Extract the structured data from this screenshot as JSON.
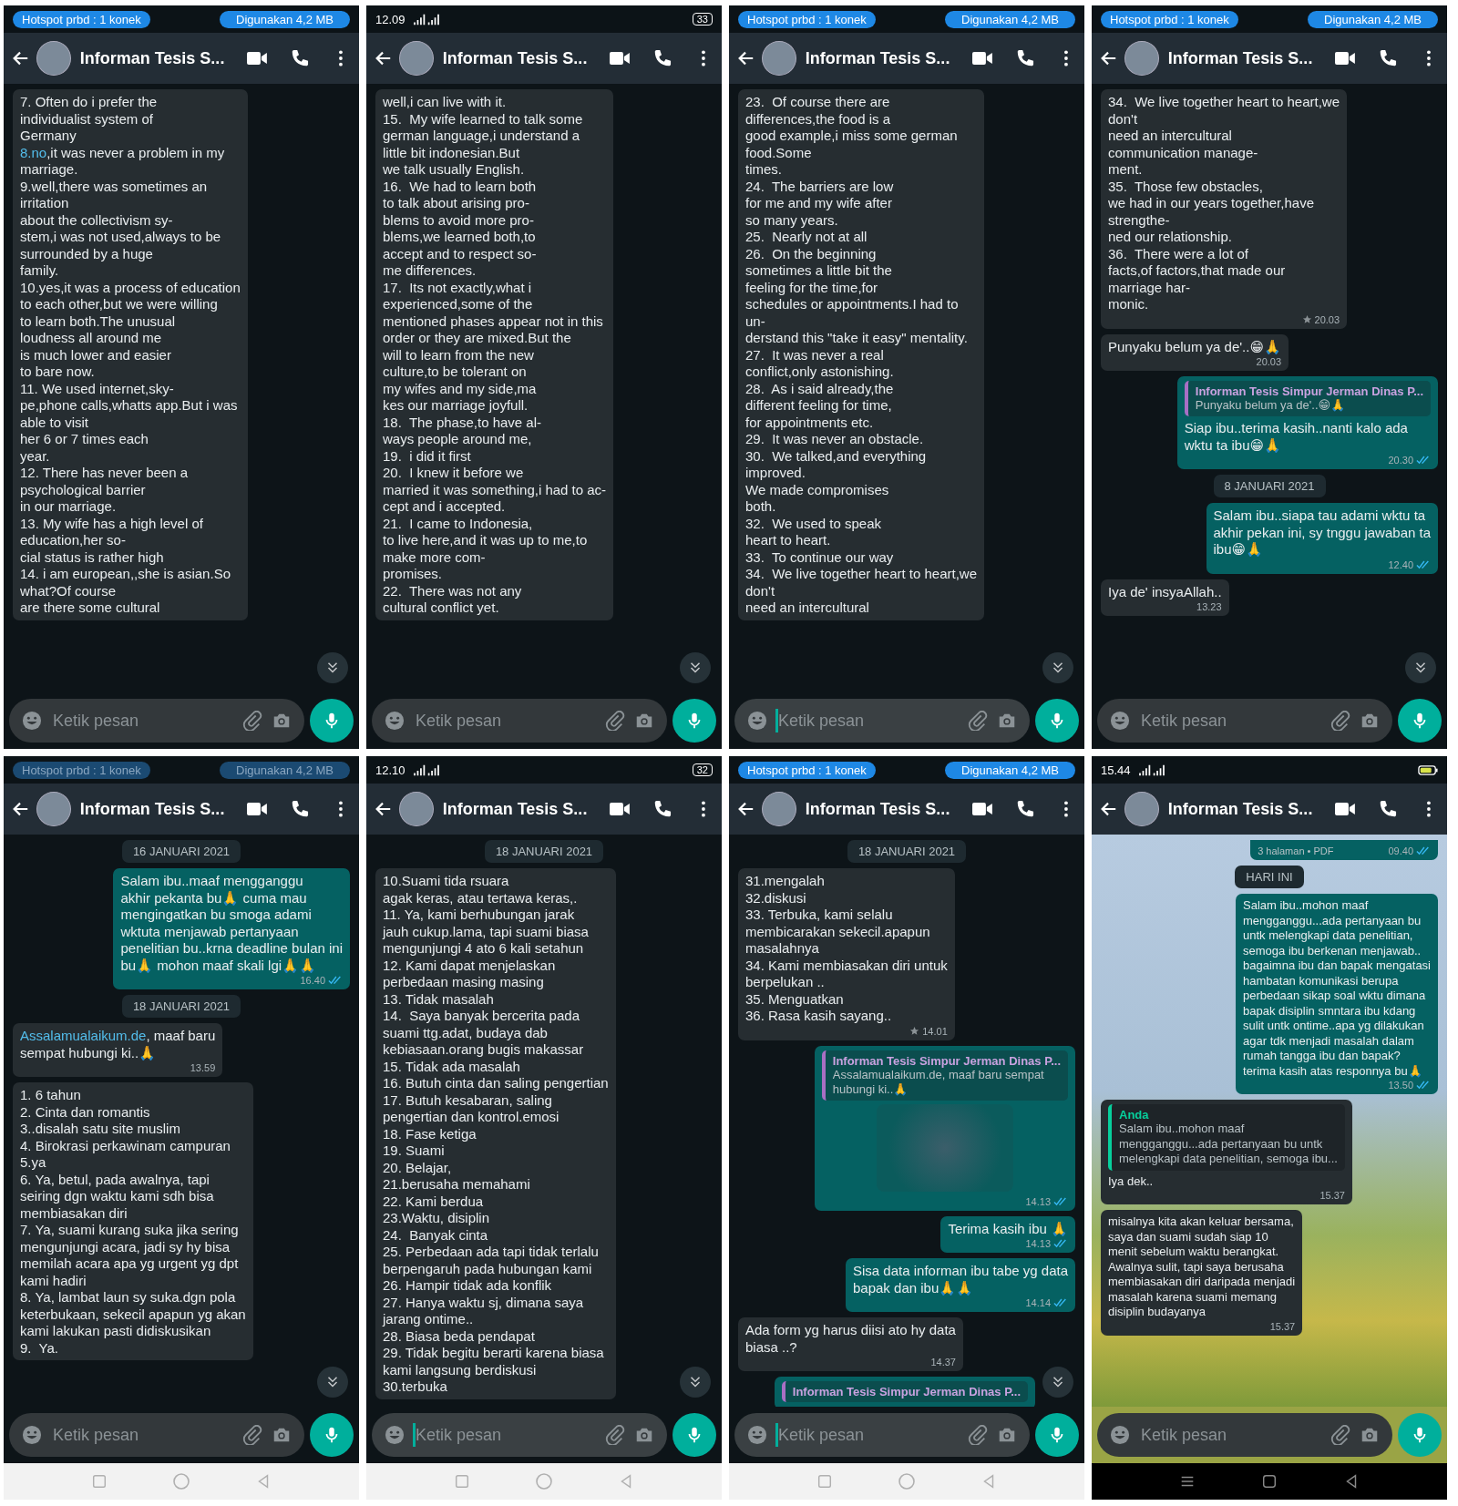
{
  "panels": [
    {
      "status_bar": {
        "kind": "hotspot",
        "hotspot": "Hotspot prbd : 1 konek",
        "usage": "Digunakan 4,2 MB",
        "faded": false
      },
      "header": {
        "title": "Informan Tesis S..."
      },
      "wallpaper": false,
      "scroll_button": true,
      "composer": {
        "placeholder": "Ketik pesan",
        "focused": false
      },
      "messages": [
        {
          "kind": "in",
          "parts": [
            {
              "text": "7. Often do i prefer the\nindividualist system of\nGermany\n",
              "link": false
            },
            {
              "text": "8.no",
              "link": true
            },
            {
              "text": ",it was never a problem in my\nmarriage.\n9.well,there was sometimes an\nirritation\nabout the collectivism sy-\nstem,i was not used,always to be\nsurrounded by a huge\nfamily.\n10.yes,it was a process of education\nto each other,but we were willing\nto learn both.The unusual\nloudness all around me\nis much lower and easier\nto bare now.\n11. We used internet,sky-\npe,phone calls,whatts app.But i was\nable to visit\nher 6 or 7 times each\nyear.\n12. There has never been a\npsychological barrier\nin our marriage.\n13. My wife has a high level of\neducation,her so-\ncial status is rather high\n14. i am european,,she is asian.So\nwhat?Of course\nare there some cultural",
              "link": false
            }
          ]
        }
      ]
    },
    {
      "status_bar": {
        "kind": "phone",
        "time": "12.09",
        "battery": "33"
      },
      "header": {
        "title": "Informan Tesis S..."
      },
      "wallpaper": false,
      "scroll_button": true,
      "composer": {
        "placeholder": "Ketik pesan",
        "focused": false
      },
      "messages": [
        {
          "kind": "in",
          "text": "well,i can live with it.\n15.  My wife learned to talk some\ngerman language,i understand a\nlittle bit indonesian.But\nwe talk usually English.\n16.  We had to learn both\nto talk about arising pro-\nblems to avoid more pro-\nblems,we learned both,to\naccept and to respect so-\nme differences.\n17.  Its not exactly,what i\nexperienced,some of the\nmentioned phases appear not in this\norder or they are mixed.But the\nwill to learn from the new\nculture,to be tolerant on\nmy wifes and my side,ma\nkes our marriage joyfull.\n18.  The phase,to have al-\nways people around me,\n19.  i did it first\n20.  I knew it before we\nmarried it was something,i had to ac-\ncept and i accepted.\n21.  I came to Indonesia,\nto live here,and it was up to me,to\nmake more com-\npromises.\n22.  There was not any\ncultural conflict yet."
        }
      ]
    },
    {
      "status_bar": {
        "kind": "hotspot",
        "hotspot": "Hotspot prbd : 1 konek",
        "usage": "Digunakan 4,2 MB",
        "faded": false
      },
      "header": {
        "title": "Informan Tesis S..."
      },
      "wallpaper": false,
      "scroll_button": true,
      "composer": {
        "placeholder": "Ketik pesan",
        "focused": true
      },
      "messages": [
        {
          "kind": "in",
          "text": "23.  Of course there are\ndifferences,the food is a\ngood example,i miss some german\nfood.Some\ntimes.\n24.  The barriers are low\nfor me and my wife after\nso many years.\n25.  Nearly not at all\n26.  On the beginning\nsometimes a little bit the\nfeeling for the time,for\nschedules or appointments.I had to\nun-\nderstand this \"take it easy\" mentality.\n27.  It was never a real\nconflict,only astonishing.\n28.  As i said already,the\ndifferent feeling for time,\nfor appointments etc.\n29.  It was never an obstacle.\n30.  We talked,and everything\nimproved.\nWe made compromises\nboth.\n32.  We used to speak\nheart to heart.\n33.  To continue our way\n34.  We live together heart to heart,we\ndon't\nneed an intercultural"
        }
      ]
    },
    {
      "status_bar": {
        "kind": "hotspot",
        "hotspot": "Hotspot prbd : 1 konek",
        "usage": "Digunakan 4,2 MB",
        "faded": false
      },
      "header": {
        "title": "Informan Tesis S..."
      },
      "wallpaper": false,
      "scroll_button": true,
      "composer": {
        "placeholder": "Ketik pesan",
        "focused": false
      },
      "messages": [
        {
          "kind": "in",
          "text": "34.  We live together heart to heart,we\ndon't\nneed an intercultural\ncommunication manage-\nment.\n35.  Those few obstacles,\nwe had in our years together,have\nstrengthe-\nned our relationship.\n36.  There were a lot of\nfacts,of factors,that made our\nmarriage har-\nmonic.",
          "time": "20.03",
          "starred": true
        },
        {
          "kind": "in",
          "text": "Punyaku belum ya de'..😁🙏",
          "time": "20.03",
          "starred": false
        },
        {
          "kind": "out",
          "quote": {
            "author": "Informan Tesis Simpur Jerman Dinas P...",
            "text": "Punyaku belum ya de'..😁🙏"
          },
          "text": "Siap ibu..terima kasih..nanti kalo ada\nwktu ta ibu😁🙏",
          "time": "20.30",
          "read": true
        },
        {
          "kind": "date",
          "text": "8 JANUARI 2021"
        },
        {
          "kind": "out",
          "text": "Salam ibu..siapa tau adami wktu ta\nakhir pekan ini, sy tnggu jawaban ta\nibu😁🙏",
          "time": "12.40",
          "read": true
        },
        {
          "kind": "in",
          "text": "Iya de' insyaAllah..",
          "time": "13.23",
          "starred": false
        }
      ]
    },
    {
      "status_bar": {
        "kind": "hotspot",
        "hotspot": "Hotspot prbd : 1 konek",
        "usage": "Digunakan 4,2 MB",
        "faded": true
      },
      "header": {
        "title": "Informan Tesis S..."
      },
      "wallpaper": false,
      "scroll_button": true,
      "composer": {
        "placeholder": "Ketik pesan",
        "focused": false
      },
      "nav_bar": {
        "kind": "light"
      },
      "messages": [
        {
          "kind": "date",
          "text": "16 JANUARI 2021"
        },
        {
          "kind": "out",
          "text": "Salam ibu..maaf mengganggu\nakhir pekanta bu🙏 cuma mau\nmengingatkan bu smoga adami\nwktuta menjawab pertanyaan\npenelitian bu..krna deadline bulan ini\nbu🙏 mohon maaf skali lgi🙏🙏",
          "time": "16.40",
          "read": true
        },
        {
          "kind": "date",
          "text": "18 JANUARI 2021"
        },
        {
          "kind": "in",
          "parts": [
            {
              "text": "Assalamualaikum.de",
              "link": true
            },
            {
              "text": ", maaf baru\nsempat hubungi ki..🙏",
              "link": false
            }
          ],
          "time": "13.59",
          "starred": false
        },
        {
          "kind": "in",
          "text": "1. 6 tahun\n2. Cinta dan romantis\n3..disalah satu site muslim\n4. Birokrasi perkawinam campuran\n5.ya\n6. Ya, betul, pada awalnya, tapi\nseiring dgn waktu kami sdh bisa\nmembiasakan diri\n7. Ya, suami kurang suka jika sering\nmengunjungi acara, jadi sy hy bisa\nmemilah acara apa yg urgent yg dpt\nkami hadiri\n8. Ya, lambat laun sy suka.dgn pola\nketerbukaan, sekecil apapun yg akan\nkami lakukan pasti didiskusikan\n9.  Ya."
        }
      ]
    },
    {
      "status_bar": {
        "kind": "phone",
        "time": "12.10",
        "battery": "32"
      },
      "header": {
        "title": "Informan Tesis S..."
      },
      "wallpaper": false,
      "scroll_button": true,
      "composer": {
        "placeholder": "Ketik pesan",
        "focused": true
      },
      "nav_bar": {
        "kind": "light"
      },
      "messages": [
        {
          "kind": "date",
          "text": "18 JANUARI 2021"
        },
        {
          "kind": "in",
          "text": "10.Suami tida rsuara\nagak keras, atau tertawa keras,.\n11. Ya, kami berhubungan jarak\njauh cukup.lama, tapi suami biasa\nmengunjungi 4 ato 6 kali setahun\n12. Kami dapat menjelaskan\nperbedaan masing masing\n13. Tidak masalah\n14.  Saya banyak bercerita pada\nsuami ttg.adat, budaya dab\nkebiasaan.orang bugis makassar\n15. Tidak ada masalah\n16. Butuh cinta dan saling pengertian\n17. Butuh kesabaran, saling\npengertian dan kontrol.emosi\n18. Fase ketiga\n19. Suami\n20. Belajar,\n21.berusaha memahami\n22. Kami berdua\n23.Waktu, disiplin\n24.  Banyak cinta\n25. Perbedaan ada tapi tidak terlalu\nberpengaruh pada hubungan kami\n26. Hampir tidak ada konflik\n27. Hanya waktu sj, dimana saya\njarang ontime..\n28. Biasa beda pendapat\n29. Tidak begitu berarti karena biasa\nkami langsung berdiskusi\n30.terbuka"
        }
      ]
    },
    {
      "status_bar": {
        "kind": "hotspot",
        "hotspot": "Hotspot prbd : 1 konek",
        "usage": "Digunakan 4,2 MB",
        "faded": false
      },
      "header": {
        "title": "Informan Tesis S..."
      },
      "wallpaper": false,
      "scroll_button": true,
      "composer": {
        "placeholder": "Ketik pesan",
        "focused": true
      },
      "nav_bar": {
        "kind": "light"
      },
      "messages": [
        {
          "kind": "date",
          "text": "18 JANUARI 2021"
        },
        {
          "kind": "in",
          "text": "31.mengalah\n32.diskusi\n33. Terbuka, kami selalu\nmembicarakan sekecil.apapun\nmasalahnya\n34. Kami membiasakan diri untuk\nberpelukan ..\n35. Menguatkan\n36. Rasa kasih sayang..",
          "time": "14.01",
          "starred": true
        },
        {
          "kind": "out",
          "quote": {
            "author": "Informan Tesis Simpur Jerman Dinas P...",
            "text": "Assalamualaikum.de, maaf baru sempat\nhubungi ki..🙏"
          },
          "sticker": true,
          "time": "14.13",
          "read": true
        },
        {
          "kind": "out",
          "text": "Terima kasih ibu 🙏",
          "time": "14.13",
          "read": true
        },
        {
          "kind": "out",
          "text": "Sisa data informan ibu tabe yg data\nbapak dan ibu🙏🙏",
          "time": "14.14",
          "read": true
        },
        {
          "kind": "in",
          "text": "Ada form yg harus diisi ato hy data\nbiasa ..?",
          "time": "14.37",
          "starred": false
        },
        {
          "kind": "out",
          "quote": {
            "author": "Informan Tesis Simpur Jerman Dinas P..."
          }
        }
      ]
    },
    {
      "status_bar": {
        "kind": "phone",
        "time": "15.44"
      },
      "header": {
        "title": "Informan Tesis S..."
      },
      "wallpaper": true,
      "scroll_button": false,
      "composer": {
        "placeholder": "Ketik pesan",
        "focused": false
      },
      "nav_bar": {
        "kind": "dark"
      },
      "messages": [
        {
          "kind": "doc",
          "text": "3 halaman • PDF",
          "time": "09.40",
          "read": true
        },
        {
          "kind": "date",
          "text": "HARI INI"
        },
        {
          "kind": "out",
          "text": "Salam ibu..mohon maaf\nmengganggu...ada pertanyaan bu\nuntk melengkapi data penelitian,\nsemoga ibu berkenan menjawab..\nbagaimna ibu dan bapak mengatasi\nhambatan komunikasi berupa\nperbedaan sikap soal wktu dimana\nbapak disiplin smntara ibu kdang\nsulit untk ontime..apa yg dilakukan\nagar tdk menjadi masalah dalam\nrumah tangga ibu dan bapak?\nterima kasih atas responnya bu🙏",
          "time": "13.50",
          "read": true
        },
        {
          "kind": "in",
          "quote": {
            "author": "Anda",
            "text": "Salam ibu..mohon maaf\nmengganggu...ada pertanyaan bu untk\nmelengkapi data penelitian, semoga ibu..."
          },
          "text": "Iya dek..",
          "time": "15.37",
          "starred": false
        },
        {
          "kind": "in",
          "text": "misalnya kita akan keluar bersama,\nsaya dan suami sudah siap 10\nmenit sebelum waktu berangkat.\nAwalnya sulit, tapi saya berusaha\nmembiasakan diri daripada menjadi\nmasalah karena suami memang\ndisiplin budayanya",
          "time": "15.37",
          "starred": false
        }
      ]
    }
  ]
}
